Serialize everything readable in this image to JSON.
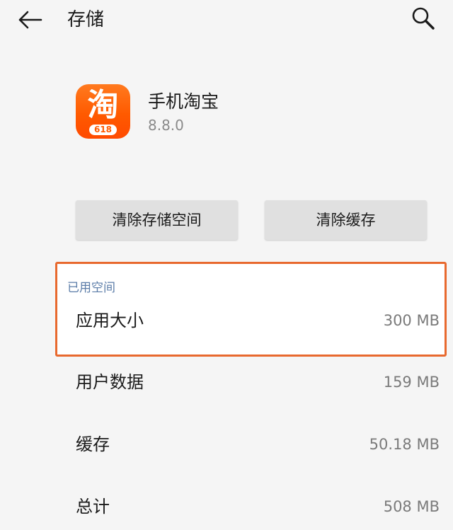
{
  "header": {
    "title": "存储",
    "back_icon": "arrow-left-icon",
    "search_icon": "search-icon"
  },
  "app": {
    "name": "手机淘宝",
    "version": "8.8.0",
    "icon_glyph": "淘",
    "icon_badge": "618",
    "icon_color": "#ff5a00"
  },
  "actions": {
    "clear_storage_label": "清除存储空间",
    "clear_cache_label": "清除缓存"
  },
  "storage": {
    "section_label": "已用空间",
    "highlight_color": "#e8692e",
    "rows": [
      {
        "label": "应用大小",
        "value": "300 MB"
      },
      {
        "label": "用户数据",
        "value": "159 MB"
      },
      {
        "label": "缓存",
        "value": "50.18 MB"
      },
      {
        "label": "总计",
        "value": "508 MB"
      }
    ]
  }
}
